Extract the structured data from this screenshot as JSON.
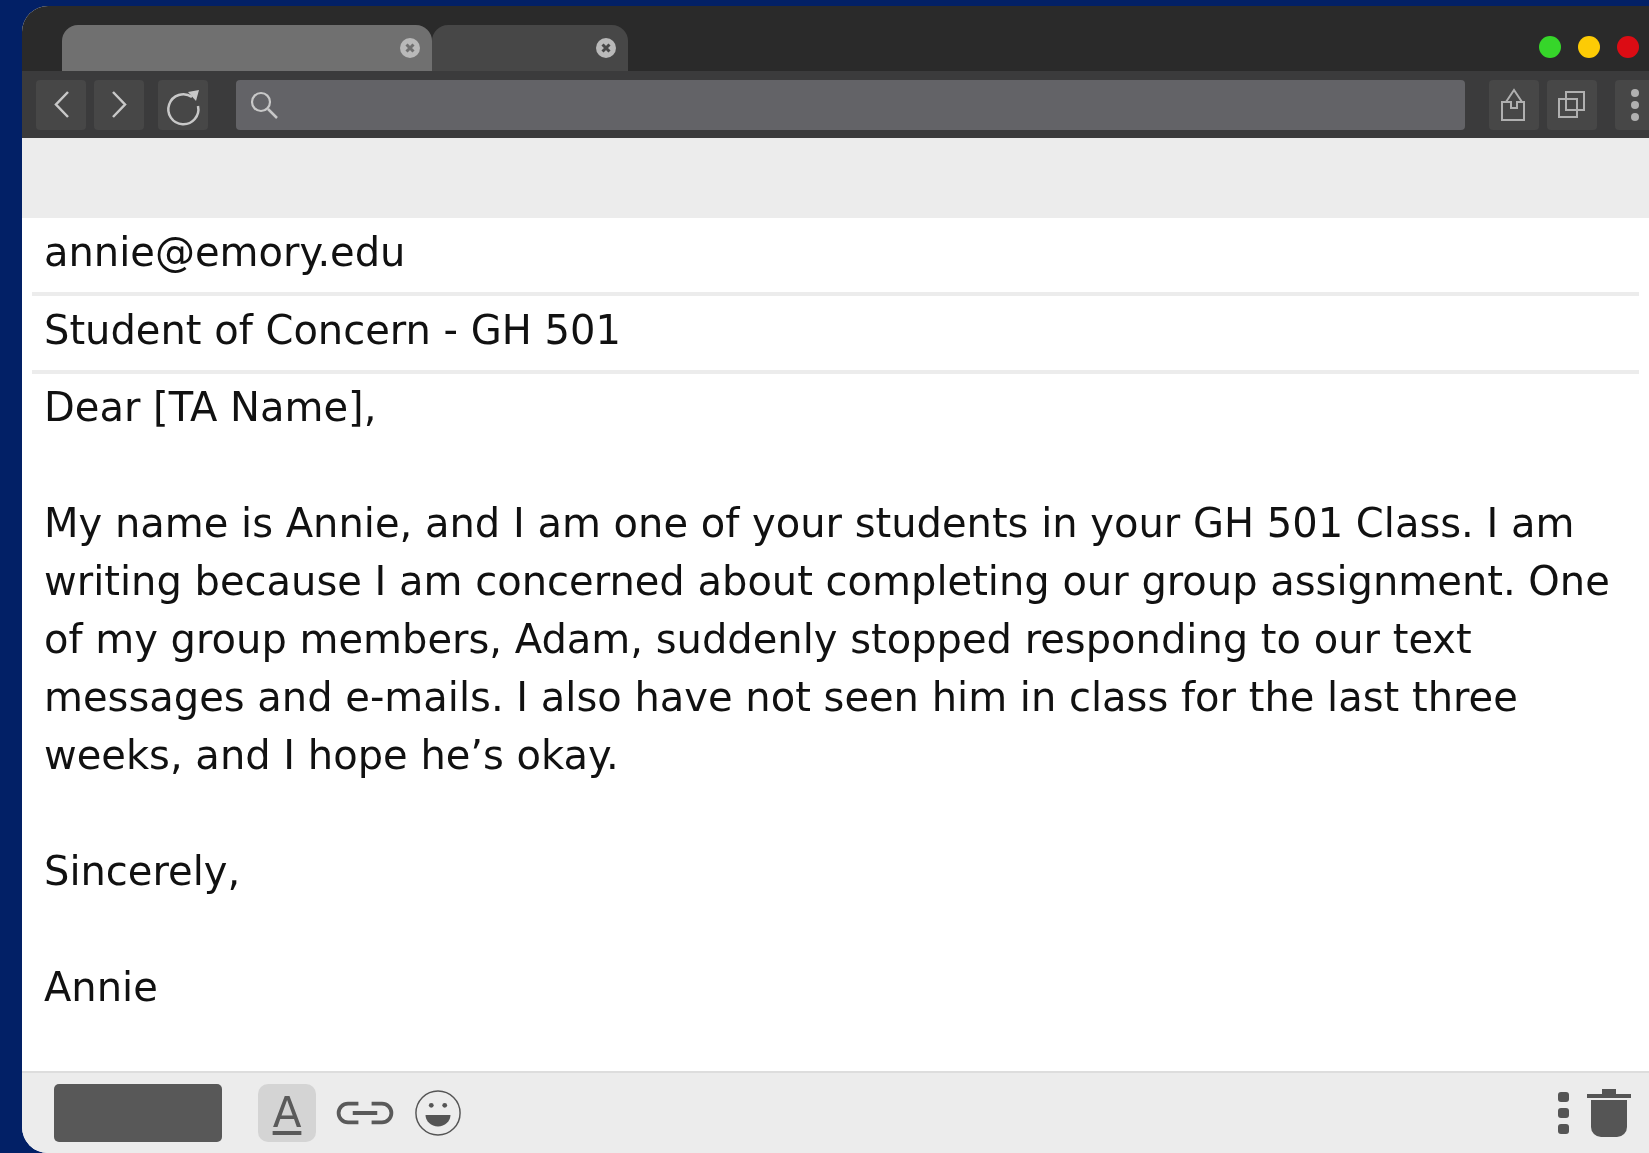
{
  "tabs": [
    {
      "selected": true
    },
    {
      "selected": false
    }
  ],
  "window_controls": [
    {
      "color": "#36d62a"
    },
    {
      "color": "#fdcb05"
    },
    {
      "color": "#dc0c14"
    }
  ],
  "email": {
    "to": "annie@emory.edu",
    "subject": "Student of Concern - GH 501",
    "body": [
      "Dear [TA Name],",
      "My name is Annie, and I am one of your students in your GH 501 Class. I am writing because I am concerned about completing our group assignment. One of my group members, Adam, suddenly stopped responding to our text messages and e-mails. I also have not seen him in class for the last three weeks, and I hope he’s okay.",
      "Sincerely,",
      "Annie"
    ]
  },
  "format_button": {
    "glyph": "A"
  }
}
